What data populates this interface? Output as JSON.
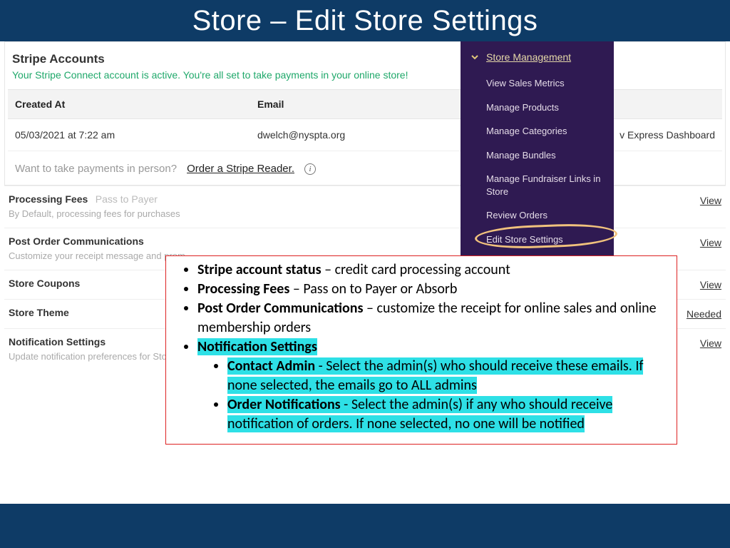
{
  "title": "Store – Edit Store Settings",
  "stripe": {
    "heading": "Stripe Accounts",
    "status": "Your Stripe Connect account is active. You're all set to take payments in your online store!",
    "cols": {
      "created": "Created At",
      "email": "Email"
    },
    "row": {
      "created": "05/03/2021 at 7:22 am",
      "email": "dwelch@nyspta.org"
    },
    "express": "v Express Dashboard",
    "reader_q": "Want to take payments in person?",
    "reader_link": "Order a Stripe Reader.",
    "info_icon": "i"
  },
  "settings": [
    {
      "title": "Processing Fees",
      "inline": "Pass to Payer",
      "sub": "By Default, processing fees for purchases",
      "action": "View"
    },
    {
      "title": "Post Order Communications",
      "inline": "",
      "sub": "Customize your receipt message and prom",
      "action": "View"
    },
    {
      "title": "Store Coupons",
      "inline": "",
      "sub": "",
      "action": "View"
    },
    {
      "title": "Store Theme",
      "inline": "",
      "sub": "",
      "action": "Needed"
    },
    {
      "title": "Notification Settings",
      "inline": "",
      "sub": "Update notification preferences for Store o",
      "action": "View"
    }
  ],
  "dropdown": {
    "header": "Store Management",
    "items": [
      "View Sales Metrics",
      "Manage Products",
      "Manage Categories",
      "Manage Bundles",
      "Manage Fundraiser Links in Store",
      "Review Orders",
      "Edit Store Settings"
    ]
  },
  "callout": {
    "b1_bold": "Stripe account status",
    "b1_rest": " – credit card processing account",
    "b2_bold": "Processing Fees",
    "b2_rest": " – Pass on to Payer or Absorb",
    "b3_bold": "Post Order Communications",
    "b3_rest": " – customize the receipt for online sales and online membership orders",
    "b4_bold": "Notification Settings",
    "s1_bold": "Contact Admin",
    "s1_rest": " - Select the admin(s) who should receive these emails. If none selected, the emails go to ALL admins",
    "s2_bold": "Order Notifications",
    "s2_rest": " - Select the admin(s) if any who should receive notification of orders. If none selected, no one will be notified"
  }
}
